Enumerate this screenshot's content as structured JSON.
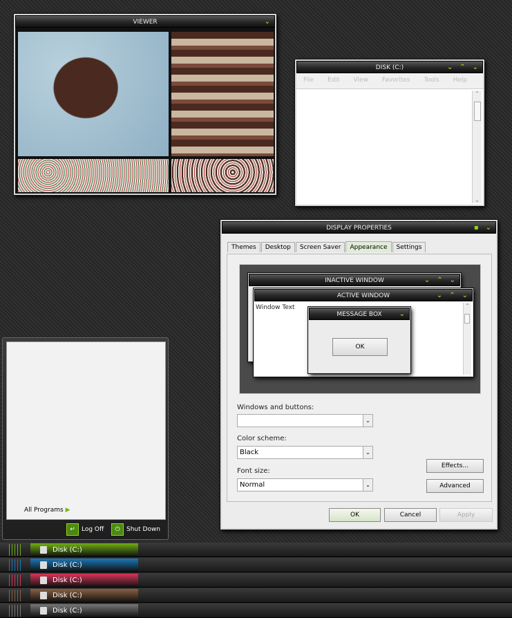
{
  "viewer": {
    "title": "VIEWER",
    "btn": "⌄"
  },
  "disk": {
    "title": "DISK (C:)",
    "menu": [
      "File",
      "Edit",
      "View",
      "Favorites",
      "Tools",
      "Help"
    ]
  },
  "display": {
    "title": "DISPLAY PROPERTIES",
    "tabs": [
      "Themes",
      "Desktop",
      "Screen Saver",
      "Appearance",
      "Settings"
    ],
    "inactive_title": "INACTIVE WINDOW",
    "active_title": "ACTIVE WINDOW",
    "window_text": "Window Text",
    "msg_title": "MESSAGE BOX",
    "msg_ok": "OK",
    "windows_buttons_label": "Windows and buttons:",
    "windows_buttons_value": "",
    "color_scheme_label": "Color scheme:",
    "color_scheme_value": "Black",
    "font_size_label": "Font size:",
    "font_size_value": "Normal",
    "effects": "Effects...",
    "advanced": "Advanced",
    "ok": "OK",
    "cancel": "Cancel",
    "apply": "Apply"
  },
  "start": {
    "all_programs": "All Programs",
    "log_off": "Log Off",
    "shut_down": "Shut Down"
  },
  "taskbars": [
    {
      "label": "Disk (C:)",
      "color": "#6fae12"
    },
    {
      "label": "Disk (C:)",
      "color": "#1a78b8"
    },
    {
      "label": "Disk (C:)",
      "color": "#d8355a"
    },
    {
      "label": "Disk (C:)",
      "color": "#8a6040"
    },
    {
      "label": "Disk (C:)",
      "color": "#777777"
    }
  ]
}
